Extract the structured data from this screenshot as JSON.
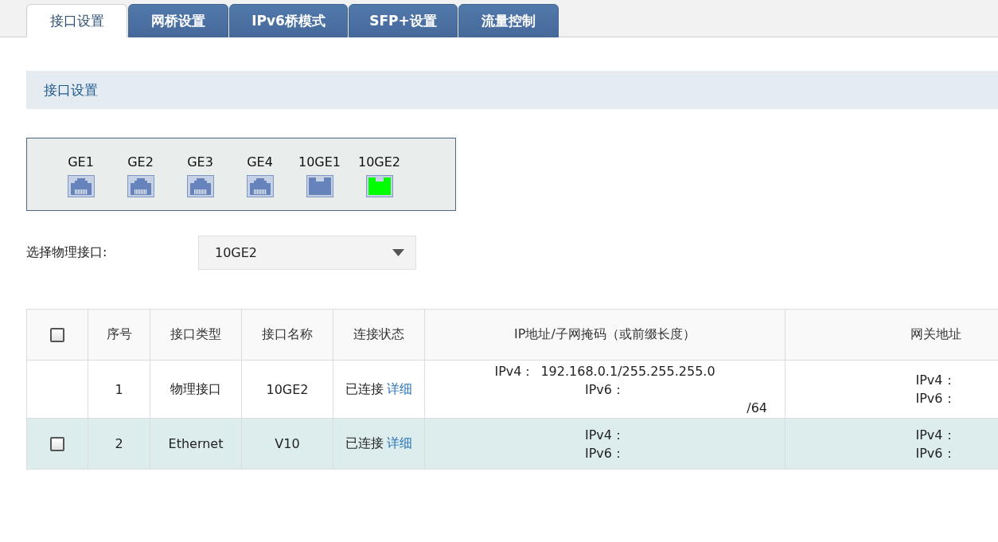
{
  "tabs": [
    {
      "label": "接口设置",
      "selected": true
    },
    {
      "label": "网桥设置",
      "selected": false
    },
    {
      "label": "IPv6桥模式",
      "selected": false
    },
    {
      "label": "SFP+设置",
      "selected": false
    },
    {
      "label": "流量控制",
      "selected": false
    }
  ],
  "section_title": "接口设置",
  "ports": [
    {
      "label": "GE1",
      "kind": "rj45",
      "connected": false
    },
    {
      "label": "GE2",
      "kind": "rj45",
      "connected": false
    },
    {
      "label": "GE3",
      "kind": "rj45",
      "connected": false
    },
    {
      "label": "GE4",
      "kind": "rj45",
      "connected": false
    },
    {
      "label": "10GE1",
      "kind": "sfp",
      "connected": false
    },
    {
      "label": "10GE2",
      "kind": "sfp",
      "connected": true
    }
  ],
  "interface_select": {
    "label": "选择物理接口:",
    "value": "10GE2"
  },
  "table": {
    "header_checkbox": {
      "checked": false
    },
    "columns": [
      "序号",
      "接口类型",
      "接口名称",
      "连接状态",
      "IP地址/子网掩码（或前缀长度）",
      "网关地址"
    ],
    "rows": [
      {
        "highlighted": false,
        "index": "1",
        "type": "物理接口",
        "name": "10GE2",
        "status": "已连接",
        "detail_link": "详细",
        "ip": [
          {
            "label": "IPv4：",
            "value": "192.168.0.1/255.255.255.0"
          },
          {
            "label": "IPv6：",
            "suffix": "/64"
          }
        ],
        "gateway": [
          {
            "label": "IPv4："
          },
          {
            "label": "IPv6："
          }
        ]
      },
      {
        "highlighted": true,
        "checkbox": {
          "checked": false
        },
        "index": "2",
        "type": "Ethernet",
        "name": "V10",
        "status": "已连接",
        "detail_link": "详细",
        "ip": [
          {
            "label": "IPv4："
          },
          {
            "label": "IPv6："
          }
        ],
        "gateway": [
          {
            "label": "IPv4："
          },
          {
            "label": "IPv6："
          }
        ]
      }
    ]
  }
}
